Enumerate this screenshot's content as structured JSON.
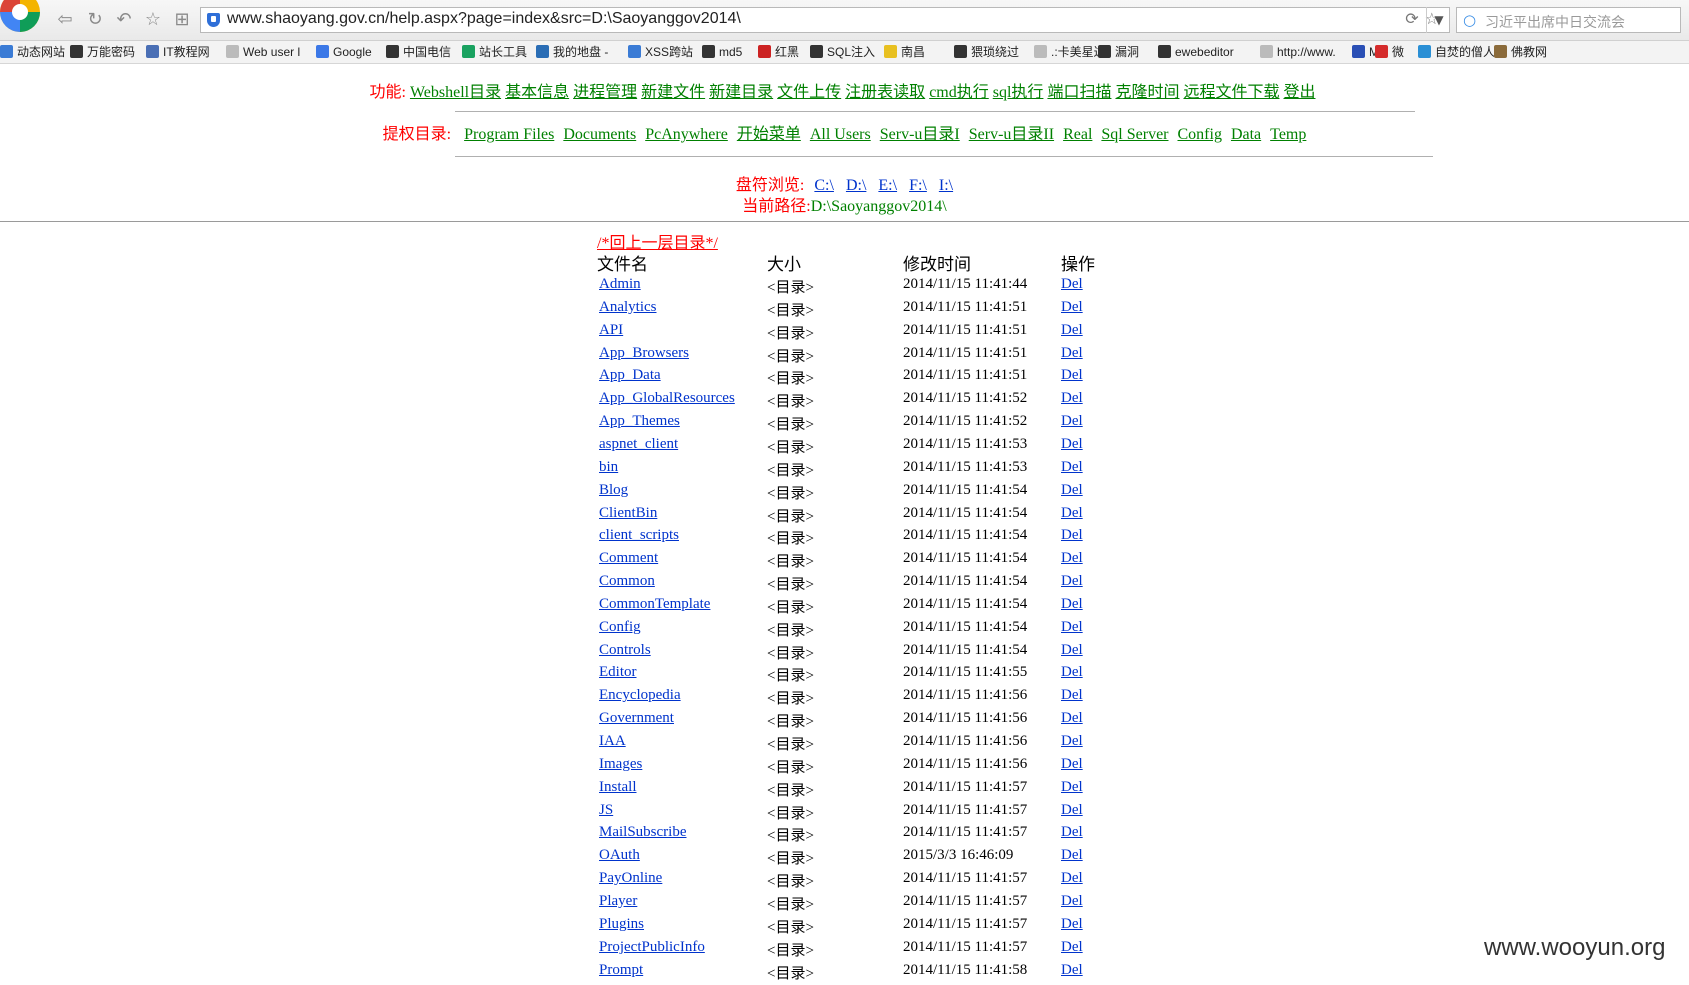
{
  "browser": {
    "url": "www.shaoyang.gov.cn/help.aspx?page=index&src=D:\\Saoyanggov2014\\",
    "search_placeholder": "习近平出席中日交流会",
    "bookmarks": [
      {
        "label": "动态网站",
        "icon_color": "#3a7bd5"
      },
      {
        "label": "万能密码",
        "icon_color": "#333333"
      },
      {
        "label": "IT教程网",
        "icon_color": "#4a6fb5"
      },
      {
        "label": "Web user l",
        "icon_color": "#bbbbbb"
      },
      {
        "label": "Google",
        "icon_color": "#3b78e7"
      },
      {
        "label": "中国电信",
        "icon_color": "#333333"
      },
      {
        "label": "站长工具",
        "icon_color": "#1aa260"
      },
      {
        "label": "我的地盘 - ",
        "icon_color": "#2a6db5"
      },
      {
        "label": "XSS跨站",
        "icon_color": "#3a7bd5"
      },
      {
        "label": "md5",
        "icon_color": "#333333"
      },
      {
        "label": "红黑",
        "icon_color": "#cc2222"
      },
      {
        "label": "SQL注入",
        "icon_color": "#333333"
      },
      {
        "label": "南昌",
        "icon_color": "#e8c020"
      },
      {
        "label": "猥琐绕过",
        "icon_color": "#333333"
      },
      {
        "label": ".:卡美星达",
        "icon_color": "#bbbbbb"
      },
      {
        "label": "漏洞",
        "icon_color": "#333333"
      },
      {
        "label": "ewebeditor",
        "icon_color": "#333333"
      },
      {
        "label": "http://www.",
        "icon_color": "#bbbbbb"
      },
      {
        "label": "M",
        "icon_color": "#2a4fb5"
      },
      {
        "label": "微",
        "icon_color": "#d52b2b"
      },
      {
        "label": "自焚的僧人",
        "icon_color": "#2a8fd5"
      },
      {
        "label": "佛教网",
        "icon_color": "#8a6a3a"
      }
    ]
  },
  "nav": {
    "func_label": "功能:",
    "func_links": [
      "Webshell目录",
      "基本信息",
      "进程管理",
      "新建文件",
      "新建目录",
      "文件上传",
      "注册表读取",
      "cmd执行",
      "sql执行",
      "端口扫描",
      "克隆时间",
      "远程文件下载",
      "登出"
    ],
    "priv_label": "提权目录:",
    "priv_links": [
      "Program Files",
      "Documents",
      "PcAnywhere",
      "开始菜单",
      "All Users",
      "Serv-u目录I",
      "Serv-u目录II",
      "Real",
      "Sql Server",
      "Config",
      "Data",
      "Temp"
    ],
    "drive_label": "盘符浏览:",
    "drives": [
      "C:\\",
      "D:\\",
      "E:\\",
      "F:\\",
      "I:\\"
    ],
    "path_label": "当前路径:",
    "path_value": "D:\\Saoyanggov2014\\"
  },
  "listing": {
    "up_link": "/*回上一层目录*/",
    "headers": {
      "name": "文件名",
      "size": "大小",
      "time": "修改时间",
      "op": "操作"
    },
    "rows": [
      {
        "name": "Admin",
        "size": "<目录>",
        "time": "2014/11/15 11:41:44",
        "op": "Del"
      },
      {
        "name": "Analytics",
        "size": "<目录>",
        "time": "2014/11/15 11:41:51",
        "op": "Del"
      },
      {
        "name": "API",
        "size": "<目录>",
        "time": "2014/11/15 11:41:51",
        "op": "Del"
      },
      {
        "name": "App_Browsers",
        "size": "<目录>",
        "time": "2014/11/15 11:41:51",
        "op": "Del"
      },
      {
        "name": "App_Data",
        "size": "<目录>",
        "time": "2014/11/15 11:41:51",
        "op": "Del"
      },
      {
        "name": "App_GlobalResources",
        "size": "<目录>",
        "time": "2014/11/15 11:41:52",
        "op": "Del"
      },
      {
        "name": "App_Themes",
        "size": "<目录>",
        "time": "2014/11/15 11:41:52",
        "op": "Del"
      },
      {
        "name": "aspnet_client",
        "size": "<目录>",
        "time": "2014/11/15 11:41:53",
        "op": "Del"
      },
      {
        "name": "bin",
        "size": "<目录>",
        "time": "2014/11/15 11:41:53",
        "op": "Del"
      },
      {
        "name": "Blog",
        "size": "<目录>",
        "time": "2014/11/15 11:41:54",
        "op": "Del"
      },
      {
        "name": "ClientBin",
        "size": "<目录>",
        "time": "2014/11/15 11:41:54",
        "op": "Del"
      },
      {
        "name": "client_scripts",
        "size": "<目录>",
        "time": "2014/11/15 11:41:54",
        "op": "Del"
      },
      {
        "name": "Comment",
        "size": "<目录>",
        "time": "2014/11/15 11:41:54",
        "op": "Del"
      },
      {
        "name": "Common",
        "size": "<目录>",
        "time": "2014/11/15 11:41:54",
        "op": "Del"
      },
      {
        "name": "CommonTemplate",
        "size": "<目录>",
        "time": "2014/11/15 11:41:54",
        "op": "Del"
      },
      {
        "name": "Config",
        "size": "<目录>",
        "time": "2014/11/15 11:41:54",
        "op": "Del"
      },
      {
        "name": "Controls",
        "size": "<目录>",
        "time": "2014/11/15 11:41:54",
        "op": "Del"
      },
      {
        "name": "Editor",
        "size": "<目录>",
        "time": "2014/11/15 11:41:55",
        "op": "Del"
      },
      {
        "name": "Encyclopedia",
        "size": "<目录>",
        "time": "2014/11/15 11:41:56",
        "op": "Del"
      },
      {
        "name": "Government",
        "size": "<目录>",
        "time": "2014/11/15 11:41:56",
        "op": "Del"
      },
      {
        "name": "IAA",
        "size": "<目录>",
        "time": "2014/11/15 11:41:56",
        "op": "Del"
      },
      {
        "name": "Images",
        "size": "<目录>",
        "time": "2014/11/15 11:41:56",
        "op": "Del"
      },
      {
        "name": "Install",
        "size": "<目录>",
        "time": "2014/11/15 11:41:57",
        "op": "Del"
      },
      {
        "name": "JS",
        "size": "<目录>",
        "time": "2014/11/15 11:41:57",
        "op": "Del"
      },
      {
        "name": "MailSubscribe",
        "size": "<目录>",
        "time": "2014/11/15 11:41:57",
        "op": "Del"
      },
      {
        "name": "OAuth",
        "size": "<目录>",
        "time": "2015/3/3 16:46:09",
        "op": "Del"
      },
      {
        "name": "PayOnline",
        "size": "<目录>",
        "time": "2014/11/15 11:41:57",
        "op": "Del"
      },
      {
        "name": "Player",
        "size": "<目录>",
        "time": "2014/11/15 11:41:57",
        "op": "Del"
      },
      {
        "name": "Plugins",
        "size": "<目录>",
        "time": "2014/11/15 11:41:57",
        "op": "Del"
      },
      {
        "name": "ProjectPublicInfo",
        "size": "<目录>",
        "time": "2014/11/15 11:41:57",
        "op": "Del"
      },
      {
        "name": "Prompt",
        "size": "<目录>",
        "time": "2014/11/15 11:41:58",
        "op": "Del"
      }
    ]
  },
  "watermark": "www.wooyun.org"
}
